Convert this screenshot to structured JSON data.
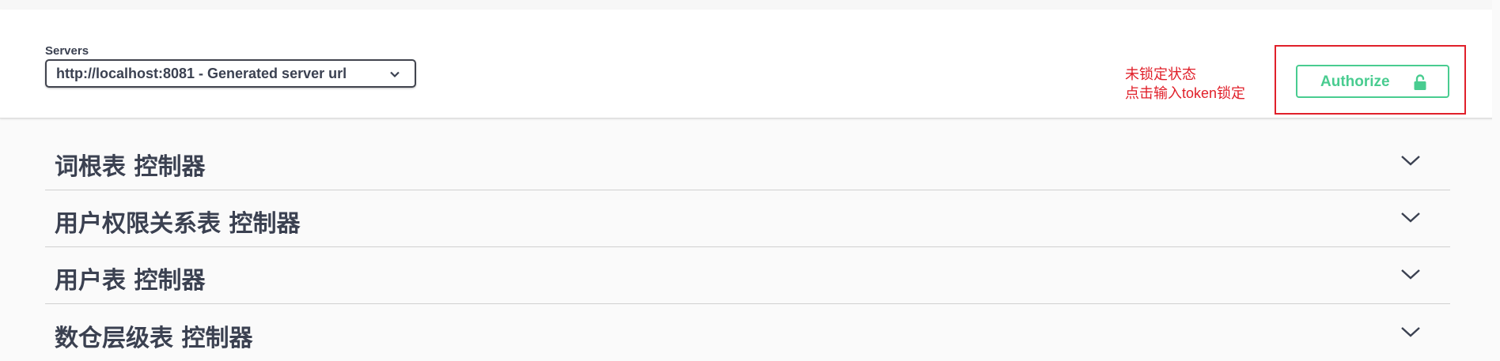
{
  "servers": {
    "label": "Servers",
    "selected": "http://localhost:8081 - Generated server url"
  },
  "annotation": {
    "line1": "未锁定状态",
    "line2": "点击输入token锁定",
    "color": "#e0202a"
  },
  "authorize": {
    "label": "Authorize",
    "icon": "unlocked-padlock-icon",
    "color": "#49cc90"
  },
  "tags": [
    {
      "title": "词根表 控制器"
    },
    {
      "title": "用户权限关系表 控制器"
    },
    {
      "title": "用户表 控制器"
    },
    {
      "title": "数仓层级表 控制器"
    }
  ]
}
